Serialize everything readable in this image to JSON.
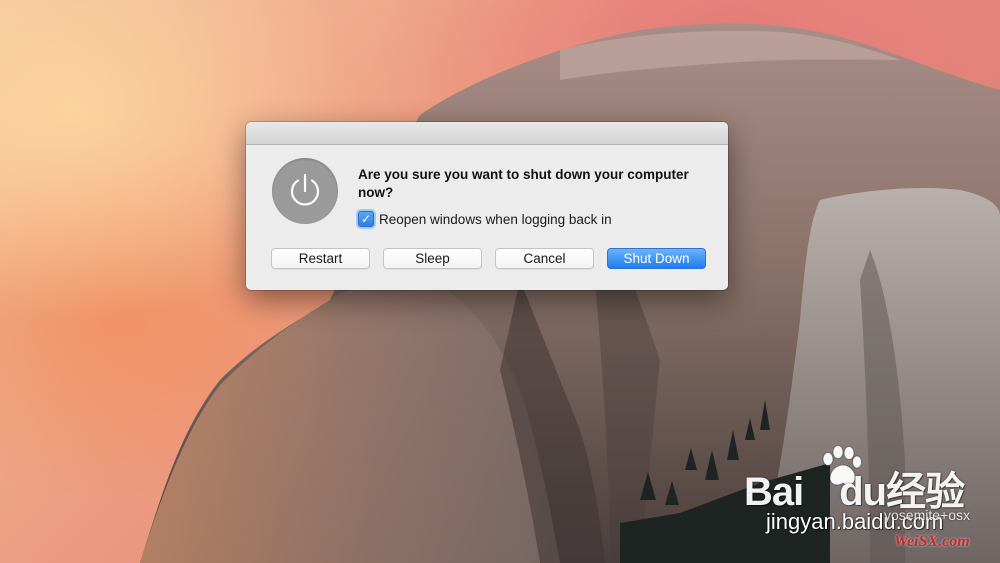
{
  "dialog": {
    "message": "Are you sure you want to shut down your computer now?",
    "icon": "power-icon",
    "checkbox": {
      "label": "Reopen windows when logging back in",
      "checked": true
    },
    "buttons": {
      "restart": "Restart",
      "sleep": "Sleep",
      "cancel": "Cancel",
      "shutdown": "Shut Down"
    }
  },
  "watermark": {
    "brand_text": "Bai",
    "brand_du": "du",
    "brand_cn": "经验",
    "url": "jingyan.baidu.com",
    "osx_text": "yosemite+osx",
    "site": "WeiSX.com"
  },
  "colors": {
    "accent": "#1f7cf0",
    "dialog_bg": "#ececec"
  }
}
